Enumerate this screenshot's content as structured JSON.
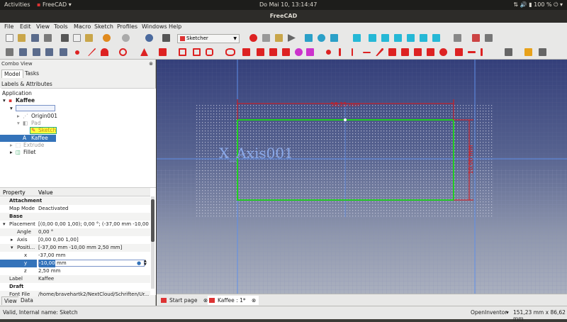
{
  "system_bar": {
    "activities": "Activities",
    "app_name": "FreeCAD",
    "clock": "Do Mai 10, 13:14:47",
    "battery": "100 %"
  },
  "window": {
    "title": "FreeCAD"
  },
  "menu": [
    "File",
    "Edit",
    "View",
    "Tools",
    "Macro",
    "Sketch",
    "Profiles",
    "Windows",
    "Help"
  ],
  "toolbar": {
    "workbench": "Sketcher"
  },
  "combo_view": {
    "title": "Combo View",
    "tabs": [
      "Model",
      "Tasks"
    ],
    "section": "Labels & Attributes",
    "tree": {
      "root": "Application",
      "items": [
        "Kaffee",
        "Origin001",
        "Pad",
        "Sketch",
        "Kaffee",
        "Extrude",
        "Fillet"
      ]
    }
  },
  "properties": {
    "col_property": "Property",
    "col_value": "Value",
    "rows": [
      {
        "name": "Attachment",
        "value": ""
      },
      {
        "name": "Map Mode",
        "value": "Deactivated"
      },
      {
        "name": "Base",
        "value": ""
      },
      {
        "name": "Placement",
        "value": "[(0,00 0,00 1,00); 0,00 °; (-37,00 mm  -10,00 mm ..."
      },
      {
        "name": "Angle",
        "value": "0,00 °"
      },
      {
        "name": "Axis",
        "value": "[0,00 0,00 1,00]"
      },
      {
        "name": "Positi...",
        "value": "[-37,00 mm  -10,00 mm  2,50 mm]"
      },
      {
        "name": "x",
        "value": "-37,00 mm"
      },
      {
        "name": "y",
        "value": "-10,00 mm"
      },
      {
        "name": "z",
        "value": "2,50 mm"
      },
      {
        "name": "Label",
        "value": "Kaffee"
      },
      {
        "name": "Draft",
        "value": ""
      },
      {
        "name": "Font File",
        "value": "/home/bravehartk2/NextCloud/Schriften/Ur..."
      }
    ],
    "y_edit_value": "-10,00",
    "y_edit_unit": "mm"
  },
  "bottom_tabs": [
    "View",
    "Data"
  ],
  "viewport": {
    "axis_label": "X_Axis001",
    "dim_top": "58,25 mm",
    "dim_right": "10,00 mm",
    "colors": {
      "sketch_green": "#22cc22",
      "dimension_red": "#e01515",
      "axis_blue": "#5f8fe8",
      "grid": "#c8c8dc"
    }
  },
  "doc_tabs": [
    "Start page",
    "Kaffee : 1*"
  ],
  "status": {
    "message": "Valid, Internal name: Sketch",
    "navigation": "OpenInventor",
    "dimensions": "151,23 mm x 86,62 mm"
  }
}
